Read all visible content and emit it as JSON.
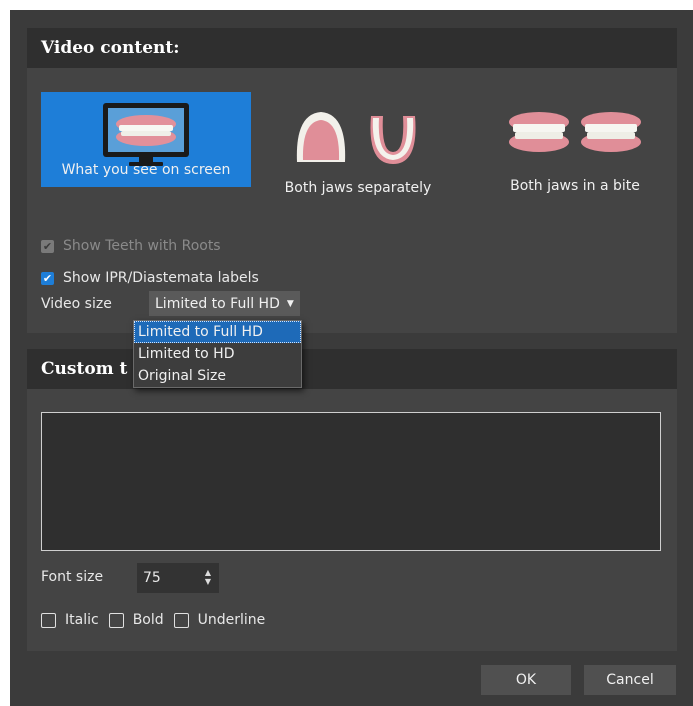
{
  "video_section": {
    "title": "Video content:",
    "modes": [
      {
        "label": "What you see on screen",
        "selected": true
      },
      {
        "label": "Both jaws separately",
        "selected": false
      },
      {
        "label": "Both jaws in a bite",
        "selected": false
      }
    ],
    "show_roots": {
      "label": "Show Teeth with Roots",
      "checked": true,
      "disabled": true
    },
    "show_ipr": {
      "label": "Show IPR/Diastemata labels",
      "checked": true
    },
    "video_size_label": "Video size",
    "video_size_value": "Limited to Full HD",
    "video_size_options": [
      "Limited to Full HD",
      "Limited to HD",
      "Original Size"
    ]
  },
  "custom_section": {
    "title_visible": "Custom t",
    "text_value": "",
    "font_size_label": "Font size",
    "font_size_value": "75",
    "italic_label": "Italic",
    "bold_label": "Bold",
    "underline_label": "Underline"
  },
  "buttons": {
    "ok": "OK",
    "cancel": "Cancel"
  },
  "colors": {
    "accent": "#1e7ed8",
    "panel": "#444444",
    "header": "#2f2f2f"
  }
}
